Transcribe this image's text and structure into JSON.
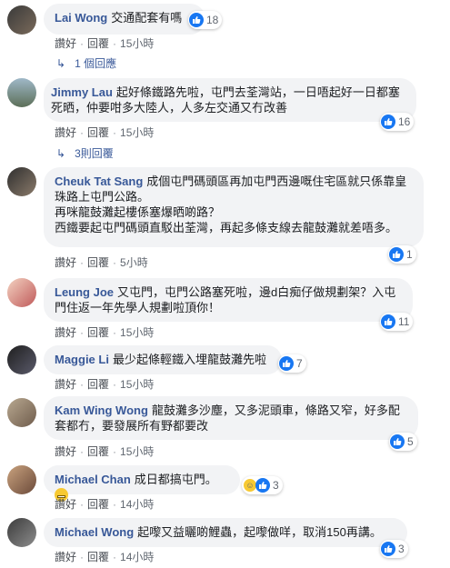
{
  "ui": {
    "like": "讚好",
    "reply": "回覆"
  },
  "colors": {
    "author": "#385898",
    "like": "#1877f2",
    "bubble": "#f2f3f5"
  },
  "comments": [
    {
      "author": "Lai Wong",
      "text": "交通配套有嗎",
      "likes": "18",
      "time": "15小時",
      "replies": "1 個回應"
    },
    {
      "author": "Jimmy Lau",
      "text": "起好條鐵路先啦，屯門去荃灣站，一日唔起好一日都塞死晒，仲要咁多大陸人，人多左交通又冇改善",
      "likes": "16",
      "time": "15小時",
      "replies": "3則回覆"
    },
    {
      "author": "Cheuk Tat Sang",
      "text": "成個屯門碼頭區再加屯門西邊嘅住宅區就只係靠皇珠路上屯門公路。\n再咪龍鼓灘起樓係塞爆晒啲路？\n西鐵要起屯門碼頭直駁出荃灣，再起多條支線去龍鼓灘就差唔多。",
      "likes": "1",
      "time": "5小時"
    },
    {
      "author": "Leung Joe",
      "text": "又屯門，屯門公路塞死啦，邊d白痴仔做規劃架？入屯門住返一年先學人規劃啦頂你！",
      "likes": "11",
      "time": "15小時"
    },
    {
      "author": "Maggie Li",
      "text": "最少起條輕鐵入埋龍鼓灘先啦",
      "likes": "7",
      "time": "15小時"
    },
    {
      "author": "Kam Wing Wong",
      "text": "龍鼓灘多沙塵，又多泥頭車，條路又窄，好多配套都冇，要發展所有野都要改",
      "likes": "5",
      "time": "15小時"
    },
    {
      "author": "Michael Chan",
      "text": "成日都搞屯門。",
      "likes": "3",
      "time": "14小時"
    },
    {
      "author": "Michael Wong",
      "text": "起嚟又益曬啲鯉蟲，起嚟做咩，取消150再講。",
      "likes": "3",
      "time": "14小時"
    }
  ]
}
